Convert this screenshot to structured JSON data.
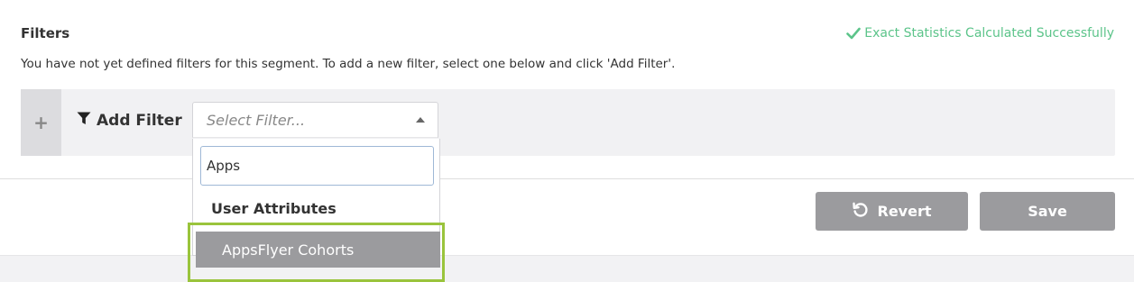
{
  "filters": {
    "title": "Filters",
    "success_message": "Exact Statistics Calculated Successfully",
    "hint": "You have not yet defined filters for this segment. To add a new filter, select one below and click 'Add Filter'.",
    "add_filter_label": "Add Filter",
    "plus_symbol": "+",
    "select": {
      "placeholder": "Select Filter..."
    },
    "dropdown": {
      "search_value": "Apps",
      "group_label": "User Attributes",
      "options": [
        {
          "label": "AppsFlyer Cohorts",
          "highlighted": true
        }
      ]
    }
  },
  "actions": {
    "revert_label": "Revert",
    "save_label": "Save"
  },
  "colors": {
    "success": "#5cc48a",
    "button_bg": "#9b9b9e",
    "highlight_frame": "#9ac43c",
    "filter_bar_bg": "#f1f1f3"
  },
  "icons": {
    "success": "check-icon",
    "filter": "funnel-icon",
    "revert": "undo-icon",
    "caret": "caret-up-icon",
    "add": "plus-icon"
  }
}
